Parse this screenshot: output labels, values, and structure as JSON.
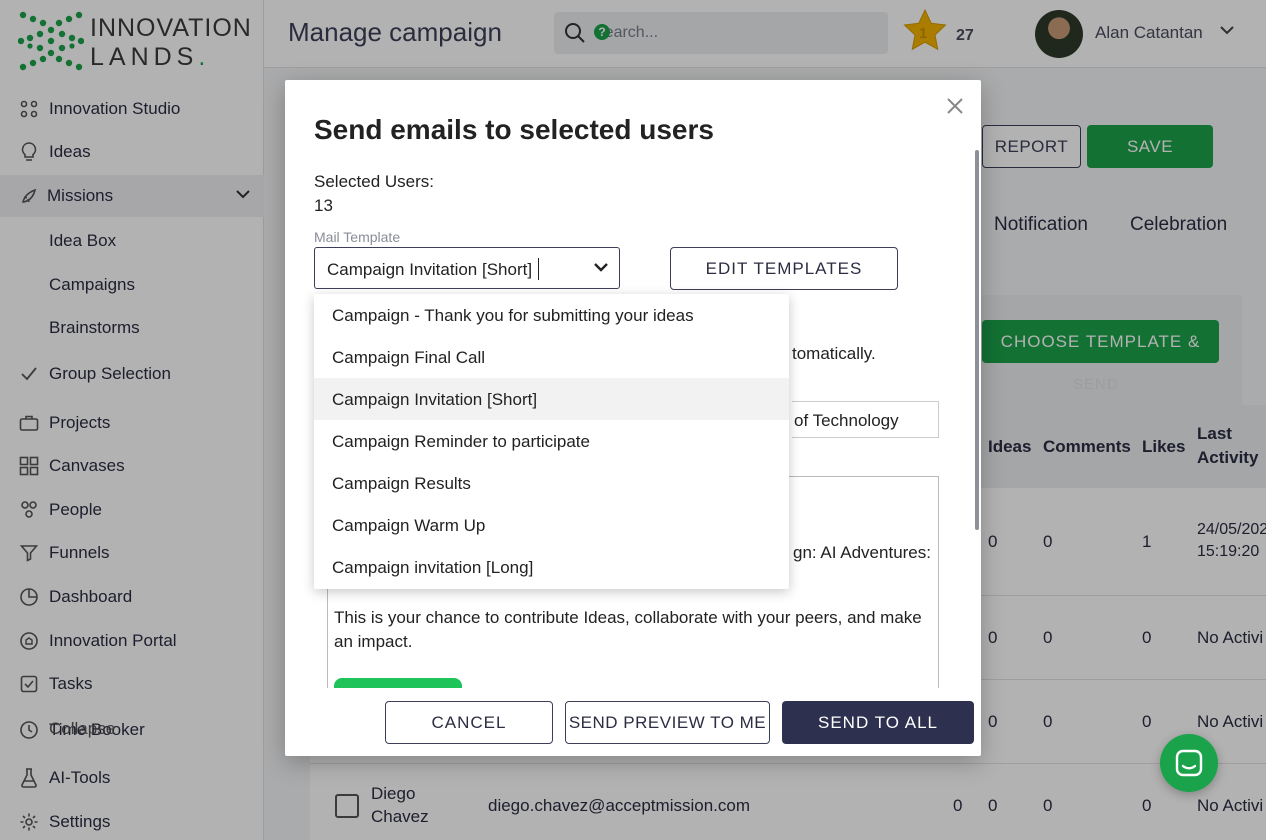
{
  "brand": {
    "line1": "INNOVATION",
    "line2": "LANDS",
    "accent": "#1aa34a"
  },
  "sidebar": {
    "items": [
      {
        "label": "Innovation Studio",
        "icon": "grid-dots-icon"
      },
      {
        "label": "Ideas",
        "icon": "lightbulb-icon"
      },
      {
        "label": "Missions",
        "icon": "rocket-icon",
        "expanded": true
      },
      {
        "label": "Idea Box"
      },
      {
        "label": "Campaigns"
      },
      {
        "label": "Brainstorms"
      },
      {
        "label": "Group Selection",
        "icon": "check-icon"
      },
      {
        "label": "Projects",
        "icon": "briefcase-icon"
      },
      {
        "label": "Canvases",
        "icon": "canvas-grid-icon"
      },
      {
        "label": "People",
        "icon": "people-icon"
      },
      {
        "label": "Funnels",
        "icon": "funnel-icon"
      },
      {
        "label": "Dashboard",
        "icon": "pie-chart-icon"
      },
      {
        "label": "Innovation Portal",
        "icon": "portal-icon"
      },
      {
        "label": "Tasks",
        "icon": "tasks-icon"
      },
      {
        "label": "Time Booker",
        "icon": "clock-icon"
      },
      {
        "label": "AI-Tools",
        "icon": "flask-icon"
      },
      {
        "label": "Settings",
        "icon": "gear-icon"
      }
    ],
    "collapse_label": "Collapse"
  },
  "topbar": {
    "title": "Manage campaign",
    "search_placeholder": "Search...",
    "level": "1",
    "points": "27",
    "user_name": "Alan Catantan"
  },
  "background": {
    "report_label": "REPORT",
    "save_label": "SAVE",
    "tabs": [
      "Notification",
      "Celebration"
    ],
    "choose_label": "CHOOSE TEMPLATE &",
    "choose_label_2": "SEND",
    "table": {
      "headers": [
        "Ideas",
        "Comments",
        "Likes",
        "Last",
        "Activity"
      ],
      "rows": [
        {
          "ideas": "0",
          "comments": "0",
          "likes": "1",
          "last_activity": "24/05/202",
          "last_activity_2": "15:19:20"
        },
        {
          "ideas": "0",
          "comments": "0",
          "likes": "0",
          "last_activity": "No Activi"
        },
        {
          "ideas": "0",
          "comments": "0",
          "likes": "0",
          "last_activity": "No Activi"
        },
        {
          "first_name": "Diego",
          "last_name": "Chavez",
          "email": "diego.chavez@acceptmission.com",
          "col0": "0",
          "ideas": "0",
          "comments": "0",
          "likes": "0",
          "last_activity": "No Activi"
        }
      ]
    }
  },
  "modal": {
    "title": "Send emails to selected users",
    "selected_users_label": "Selected Users:",
    "selected_users_count": "13",
    "mail_template_label": "Mail Template",
    "mail_template_value": "Campaign Invitation [Short]",
    "edit_templates_label": "EDIT TEMPLATES",
    "partial_text": "tomatically.",
    "subject_partial": "of Technology",
    "body_partial_line": "gn: AI Adventures:",
    "body_paragraph": "This is your chance to contribute Ideas, collaborate with your peers, and make an impact.",
    "cancel_label": "CANCEL",
    "preview_label": "SEND PREVIEW TO ME",
    "send_all_label": "SEND TO ALL"
  },
  "dropdown": {
    "options": [
      "Campaign - Thank you for submitting your ideas",
      "Campaign Final Call",
      "Campaign Invitation [Short]",
      "Campaign Reminder to participate",
      "Campaign Results",
      "Campaign Warm Up",
      "Campaign invitation [Long]"
    ],
    "selected_index": 2
  },
  "colors": {
    "primary_green": "#1aa34a",
    "dark_navy": "#2e3050"
  }
}
